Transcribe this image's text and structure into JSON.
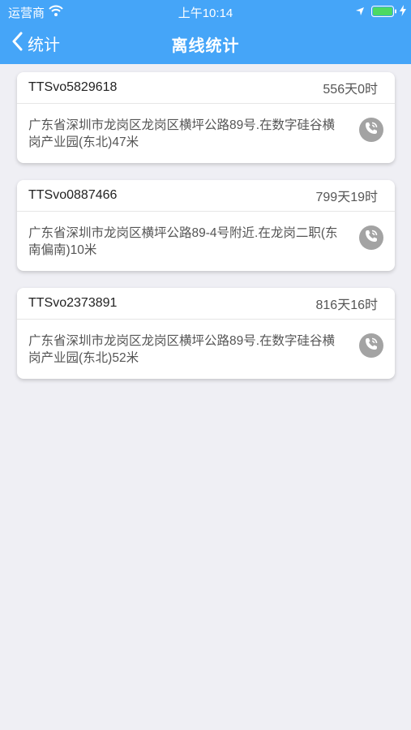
{
  "status_bar": {
    "carrier": "运营商",
    "time": "上午10:14"
  },
  "nav": {
    "back_label": "统计",
    "title": "离线统计"
  },
  "records": [
    {
      "device_id": "TTSvo5829618",
      "duration": "556天0时",
      "address": "广东省深圳市龙岗区龙岗区横坪公路89号.在数字硅谷横岗产业园(东北)47米"
    },
    {
      "device_id": "TTSvo0887466",
      "duration": "799天19时",
      "address": "广东省深圳市龙岗区横坪公路89-4号附近.在龙岗二职(东南偏南)10米"
    },
    {
      "device_id": "TTSvo2373891",
      "duration": "816天16时",
      "address": "广东省深圳市龙岗区龙岗区横坪公路89号.在数字硅谷横岗产业园(东北)52米"
    }
  ],
  "icons": {
    "back": "chevron-left-icon",
    "call": "phone-call-icon",
    "wifi": "wifi-icon",
    "location": "location-arrow-icon",
    "battery": "battery-icon",
    "charging": "charging-bolt-icon"
  },
  "colors": {
    "header": "#45a5f8",
    "background": "#efeff4",
    "battery_fill": "#4cd964",
    "call_button": "#a3a3a3"
  }
}
